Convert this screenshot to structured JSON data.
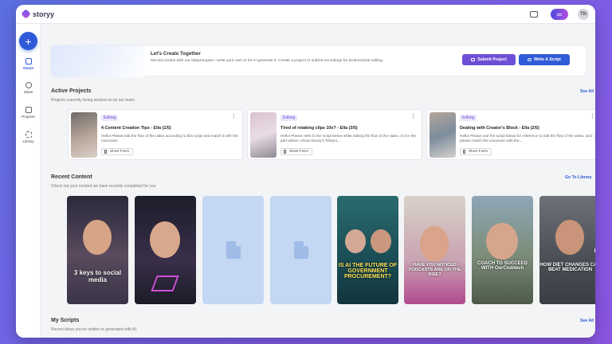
{
  "app": {
    "logo_text": "storyy",
    "user_initials": "TN",
    "credits_icon": "infinity-icon"
  },
  "sidebar": {
    "items": [
      {
        "label": "Home",
        "icon": "home-icon"
      },
      {
        "label": "Ideas",
        "icon": "lightbulb-icon"
      },
      {
        "label": "Projects",
        "icon": "folder-icon"
      },
      {
        "label": "Library",
        "icon": "grid-icon"
      }
    ]
  },
  "banner": {
    "title": "Let's Create Together",
    "description": "Record scripts with our teleprompter—write your own or let AI generate it. Create a project to submit recordings for professional editing.",
    "submit_label": "Submit Project",
    "write_label": "Write A Script"
  },
  "active_projects": {
    "title": "Active Projects",
    "subtitle": "Projects currently being worked on by our team.",
    "link": "See All",
    "items": [
      {
        "status": "Editing",
        "title": "4 Content Creation Tips - Ella (1/5)",
        "description": "Hello! Please edit the flow of the video according to this script and match it with the voiceover:",
        "type": "Short Form"
      },
      {
        "status": "Editing",
        "title": "Tired of retaking clips 10x? - Ella (3/5)",
        "description": "Hello! Please refer to the script below while editing the flow of the video. As for the part where I show Storyy's Telepro...",
        "type": "Short Form"
      },
      {
        "status": "Editing",
        "title": "Dealing with Creator's Block - Ella (2/5)",
        "description": "Hello! Please use the script below for reference to edit the flow of the video, and please match the voiceover with the...",
        "type": "Short Form"
      }
    ]
  },
  "recent_content": {
    "title": "Recent Content",
    "subtitle": "Check out your content we have recently completed for you",
    "link": "Go To Library",
    "captions": [
      "3 keys to social media",
      "",
      "",
      "",
      "IS AI THE FUTURE OF GOVERNMENT PROCUREMENT?",
      "HAVE YOU NOTICED PODCASTS ARE ON THE RISE?",
      "COACH TO SUCCEED WITH OurClubtech",
      "HOW DIET CHANGES CAN BEAT MEDICATION"
    ]
  },
  "my_scripts": {
    "title": "My Scripts",
    "subtitle": "Recent ideas you've written or generated with AI.",
    "link": "See All"
  },
  "colors": {
    "primary": "#2f5bd8",
    "purple": "#6d4fd6",
    "background": "#f3f4f6"
  }
}
